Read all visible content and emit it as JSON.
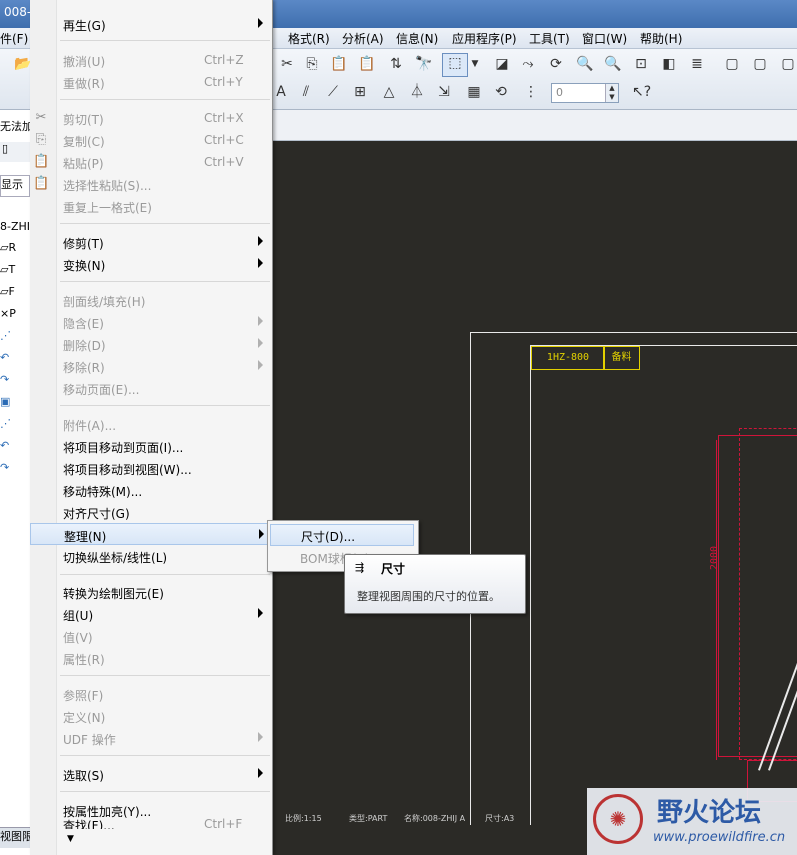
{
  "title_bar": {
    "text": "008-z"
  },
  "menubar": {
    "file_partial": "件(F)",
    "items": [
      "格式(R)",
      "分析(A)",
      "信息(N)",
      "应用程序(P)",
      "工具(T)",
      "窗口(W)",
      "帮助(H)"
    ]
  },
  "toolbar": {
    "spinner_value": "0"
  },
  "left_panel": {
    "cannot_partial": "无法加",
    "display_partial": "显示",
    "model_partial": "8-ZHI",
    "tree_letters": [
      "R",
      "T",
      "F",
      "P"
    ],
    "bottom_tab": "视图限"
  },
  "menu": {
    "items": [
      {
        "label": "再生(G)",
        "submenu": true
      },
      {
        "label": "撤消(U)",
        "shortcut": "Ctrl+Z",
        "disabled": true
      },
      {
        "label": "重做(R)",
        "shortcut": "Ctrl+Y",
        "disabled": true
      },
      {
        "label": "剪切(T)",
        "shortcut": "Ctrl+X",
        "disabled": true
      },
      {
        "label": "复制(C)",
        "shortcut": "Ctrl+C",
        "disabled": true
      },
      {
        "label": "粘贴(P)",
        "shortcut": "Ctrl+V",
        "disabled": true
      },
      {
        "label": "选择性粘贴(S)...",
        "disabled": true
      },
      {
        "label": "重复上一格式(E)",
        "disabled": true
      },
      {
        "label": "修剪(T)",
        "submenu": true
      },
      {
        "label": "变换(N)",
        "submenu": true
      },
      {
        "label": "剖面线/填充(H)",
        "disabled": true
      },
      {
        "label": "隐含(E)",
        "disabled": true,
        "submenu": true
      },
      {
        "label": "删除(D)",
        "disabled": true,
        "submenu": true
      },
      {
        "label": "移除(R)",
        "disabled": true,
        "submenu": true
      },
      {
        "label": "移动页面(E)...",
        "disabled": true
      },
      {
        "label": "附件(A)...",
        "disabled": true
      },
      {
        "label": "将项目移动到页面(I)..."
      },
      {
        "label": "将项目移动到视图(W)..."
      },
      {
        "label": "移动特殊(M)..."
      },
      {
        "label": "对齐尺寸(G)"
      },
      {
        "label": "整理(N)",
        "submenu": true,
        "highlighted": true
      },
      {
        "label": "切换纵坐标/线性(L)"
      },
      {
        "label": "转换为绘制图元(E)"
      },
      {
        "label": "组(U)",
        "submenu": true
      },
      {
        "label": "值(V)",
        "disabled": true
      },
      {
        "label": "属性(R)",
        "disabled": true
      },
      {
        "label": "参照(F)",
        "disabled": true
      },
      {
        "label": "定义(N)",
        "disabled": true
      },
      {
        "label": "UDF 操作",
        "disabled": true,
        "submenu": true
      },
      {
        "label": "选取(S)",
        "submenu": true
      },
      {
        "label": "按属性加亮(Y)..."
      },
      {
        "label": "查找(F)...",
        "shortcut": "Ctrl+F"
      }
    ]
  },
  "submenu": {
    "items": [
      {
        "label": "尺寸(D)...",
        "highlighted": true
      },
      {
        "label": "BOM球标(B)...",
        "disabled": true
      }
    ]
  },
  "tooltip": {
    "title": "尺寸",
    "description": "整理视图周围的尺寸的位置。"
  },
  "drawing": {
    "title_cell_1": "1HZ-800",
    "title_cell_2": "备料",
    "dimension_text": "2000",
    "status_scale": "比例:1:15",
    "status_type": "类型:PART",
    "status_name": "名称:008-ZHIJ A",
    "status_size": "尺寸:A3"
  },
  "watermark": {
    "title": "野火论坛",
    "url": "www.proewildfire.cn"
  },
  "colors": {
    "canvas": "#2b2a26",
    "dimension_red": "#d0143a",
    "title_yellow": "#e2d000"
  }
}
